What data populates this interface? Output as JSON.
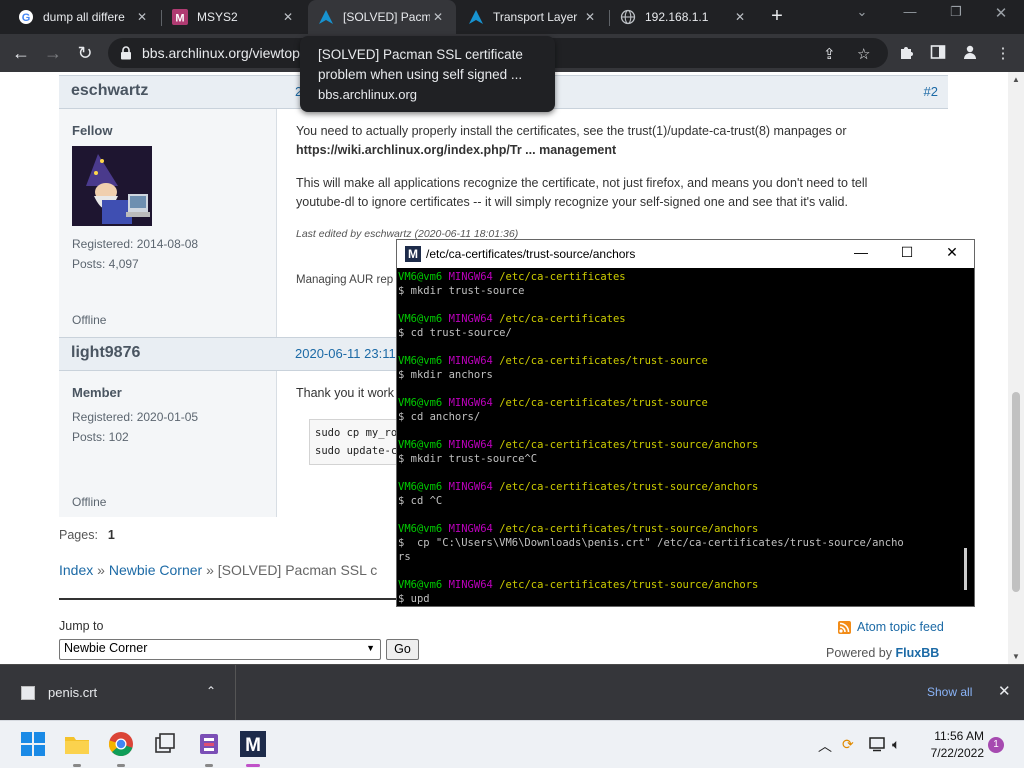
{
  "browser": {
    "tabs": [
      {
        "title": "dump all differe",
        "favicon": "google-icon"
      },
      {
        "title": "MSYS2",
        "favicon": "msys2-icon"
      },
      {
        "title": "[SOLVED] Pacm",
        "favicon": "archlinux-icon"
      },
      {
        "title": "Transport Layer",
        "favicon": "archlinux-icon"
      },
      {
        "title": "192.168.1.1",
        "favicon": "globe-icon"
      }
    ],
    "url": "bbs.archlinux.org/viewtopi",
    "tooltip": {
      "title": "[SOLVED] Pacman SSL certificate problem when using self signed ...",
      "host": "bbs.archlinux.org"
    }
  },
  "forum": {
    "post2": {
      "author": "eschwartz",
      "date": "2",
      "number": "#2",
      "role": "Fellow",
      "registered": "Registered: 2014-08-08",
      "posts": "Posts: 4,097",
      "status": "Offline",
      "para1_text": "You need to actually properly install the certificates, see the trust(1)/update-ca-trust(8) manpages or",
      "para1_link": "https://wiki.archlinux.org/index.php/Tr ... management",
      "para2": "This will make all applications recognize the certificate, not just firefox, and means you don't need to tell youtube-dl to ignore certificates -- it will simply recognize your self-signed one and see that it's valid.",
      "edited": "Last edited by eschwartz (2020-06-11 18:01:36)",
      "signature": "Managing AUR rep"
    },
    "post3": {
      "author": "light9876",
      "date": "2020-06-11 23:11",
      "role": "Member",
      "registered": "Registered: 2020-01-05",
      "posts": "Posts: 102",
      "status": "Offline",
      "text": "Thank you it work",
      "code1": "sudo cp my_roo",
      "code2": "sudo update-ca"
    },
    "pages_label": "Pages:",
    "pages_value": "1",
    "breadcrumb": {
      "index": "Index",
      "sep": "»",
      "newbie": "Newbie Corner",
      "current": "[SOLVED] Pacman SSL c"
    },
    "jump_label": "Jump to",
    "jump_value": "Newbie Corner",
    "go": "Go",
    "feed": "Atom topic feed",
    "powered_prefix": "Powered by",
    "powered_brand": "FluxBB"
  },
  "terminal": {
    "title": "/etc/ca-certificates/trust-source/anchors",
    "user": "VM6@vm6",
    "env": "MINGW64",
    "blocks": [
      {
        "path": "/etc/ca-certificates",
        "cmd": "$ mkdir trust-source"
      },
      {
        "path": "/etc/ca-certificates",
        "cmd": "$ cd trust-source/"
      },
      {
        "path": "/etc/ca-certificates/trust-source",
        "cmd": "$ mkdir anchors"
      },
      {
        "path": "/etc/ca-certificates/trust-source",
        "cmd": "$ cd anchors/"
      },
      {
        "path": "/etc/ca-certificates/trust-source/anchors",
        "cmd": "$ mkdir trust-source^C"
      },
      {
        "path": "/etc/ca-certificates/trust-source/anchors",
        "cmd": "$ cd ^C"
      },
      {
        "path": "/etc/ca-certificates/trust-source/anchors",
        "cmd": "$  cp \"C:\\Users\\VM6\\Downloads\\penis.crt\" /etc/ca-certificates/trust-source/ancho",
        "cmd2": "rs"
      },
      {
        "path": "/etc/ca-certificates/trust-source/anchors",
        "cmd": "$ upd"
      }
    ]
  },
  "downloads": {
    "file": "penis.crt",
    "show_all": "Show all"
  },
  "taskbar": {
    "time": "11:56 AM",
    "date": "7/22/2022",
    "notifications": "1"
  }
}
